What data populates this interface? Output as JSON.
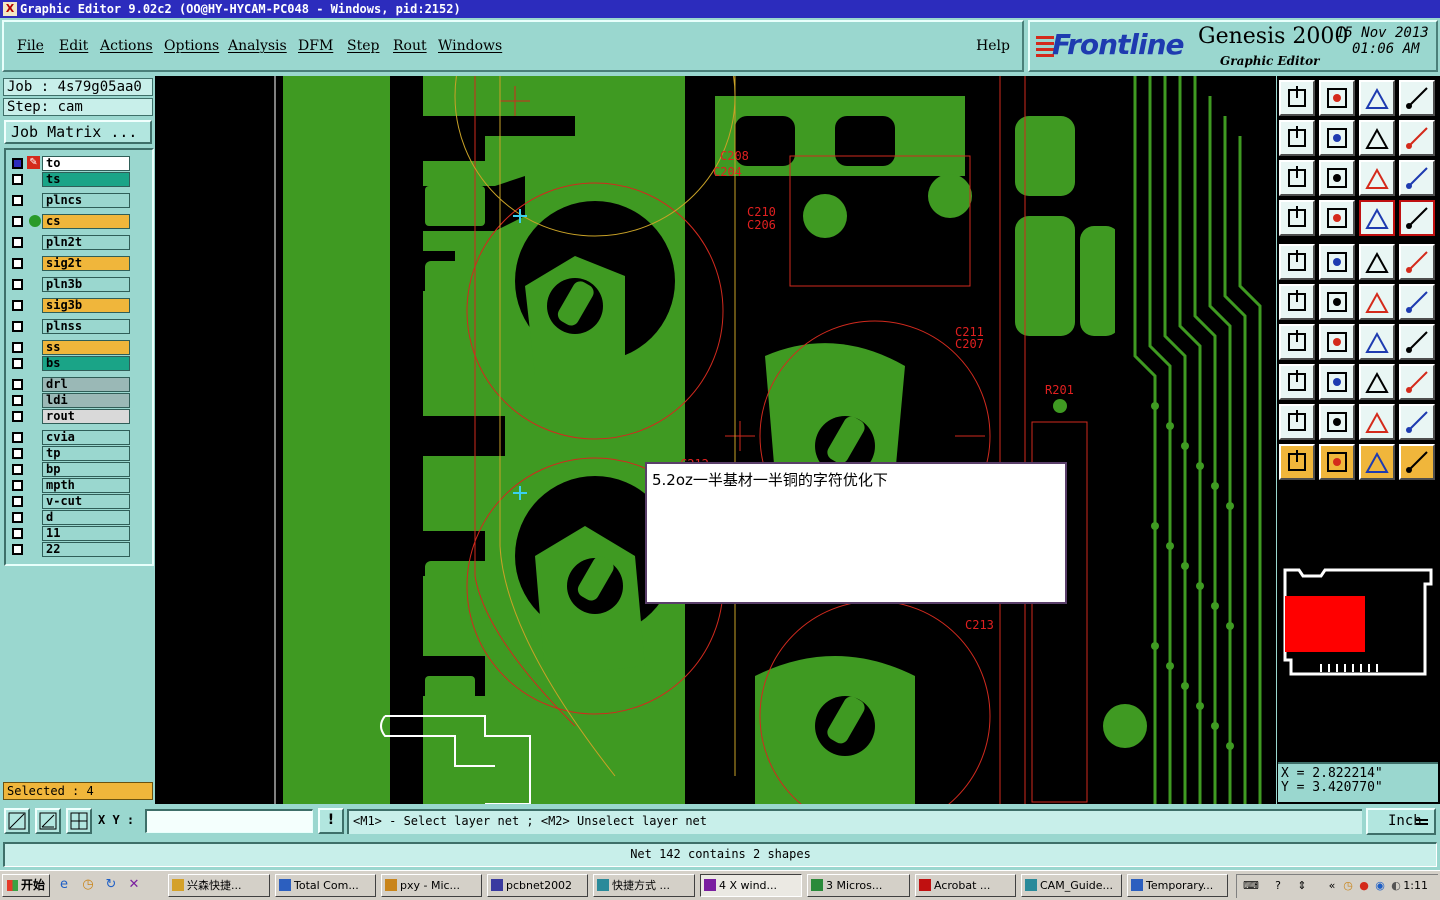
{
  "window": {
    "title": "Graphic Editor 9.02c2 (OO@HY-HYCAM-PC048 - Windows, pid:2152)",
    "title_icon": "X"
  },
  "menu": {
    "items": [
      "File",
      "Edit",
      "Actions",
      "Options",
      "Analysis",
      "DFM",
      "Step",
      "Rout",
      "Windows"
    ],
    "help": "Help"
  },
  "brand": {
    "logo": "Frontline",
    "product": "Genesis 2000",
    "subtitle": "Graphic Editor",
    "date": "15 Nov 2013",
    "time": "01:06 AM"
  },
  "job": {
    "job_text": "Job : 4s79g05aa0",
    "step_text": "Step: cam",
    "matrix_button": "Job Matrix ..."
  },
  "layers": [
    {
      "name": "to",
      "color": "#ffffff",
      "mark": "x"
    },
    {
      "name": "ts",
      "color": "#1aa487",
      "mark": ""
    },
    {
      "name": "plncs",
      "color": "#9ad7cf",
      "mark": ""
    },
    {
      "name": "cs",
      "color": "#f0b63b",
      "mark": "o"
    },
    {
      "name": "pln2t",
      "color": "#9ad7cf",
      "mark": ""
    },
    {
      "name": "sig2t",
      "color": "#f0b63b",
      "mark": ""
    },
    {
      "name": "pln3b",
      "color": "#9ad7cf",
      "mark": ""
    },
    {
      "name": "sig3b",
      "color": "#f0b63b",
      "mark": ""
    },
    {
      "name": "plnss",
      "color": "#9ad7cf",
      "mark": ""
    },
    {
      "name": "ss",
      "color": "#f0b63b",
      "mark": ""
    },
    {
      "name": "bs",
      "color": "#1aa487",
      "mark": ""
    },
    {
      "name": "drl",
      "color": "#9ab8b6",
      "mark": ""
    },
    {
      "name": "ldi",
      "color": "#9ab8b6",
      "mark": ""
    },
    {
      "name": "rout",
      "color": "#d9d9d9",
      "mark": ""
    },
    {
      "name": "cvia",
      "color": "#9ad7cf",
      "mark": ""
    },
    {
      "name": "tp",
      "color": "#9ad7cf",
      "mark": ""
    },
    {
      "name": "bp",
      "color": "#9ad7cf",
      "mark": ""
    },
    {
      "name": "mpth",
      "color": "#9ad7cf",
      "mark": ""
    },
    {
      "name": "v-cut",
      "color": "#9ad7cf",
      "mark": ""
    },
    {
      "name": "d",
      "color": "#9ad7cf",
      "mark": ""
    },
    {
      "name": "11",
      "color": "#9ad7cf",
      "mark": ""
    },
    {
      "name": "22",
      "color": "#9ad7cf",
      "mark": ""
    }
  ],
  "selected_text": "Selected : 4",
  "canvas": {
    "refdes": [
      "C208",
      "C204",
      "C210",
      "C206",
      "C211",
      "C207",
      "R201",
      "C213",
      "C212"
    ],
    "copper_color": "#3f9a22",
    "outline_color": "#d12a1e"
  },
  "popup": {
    "message": "5.2oz一半基材一半铜的字符优化下"
  },
  "tools": [
    "move-to-layer-icon",
    "copy-to-layer-icon",
    "home-icon",
    "window-icon",
    "left-arrow-icon",
    "right-arrow-icon",
    "swap-icon",
    "flip-icon",
    "zoom-fit-icon",
    "zoom-center-icon",
    "zoom-1to1-icon",
    "help-icon",
    "settings-icon",
    "grid-icon",
    "layer-stack-icon",
    "layer-stack-red-icon",
    "pad-select-icon",
    "polygon-icon",
    "ruler-icon",
    "circle-pad-icon",
    "net-icon",
    "cross-icon",
    "line-icon",
    "line-point-icon",
    "angle-icon",
    "slash-icon",
    "arc-icon",
    "mirror-icon",
    "shape-edit-icon",
    "minus-icon",
    "measure-icon",
    "group-icon",
    "triangle-icon",
    "triangle-a-icon",
    "triangle-b-icon",
    "triangle-c-icon",
    "pointer-icon",
    "pointer-box-icon",
    "pointer-box2-icon",
    "pointer-net-icon"
  ],
  "coords": {
    "x_text": "X = 2.822214\"",
    "y_text": "Y = 3.420770\""
  },
  "bottom": {
    "xy_label": "X Y :",
    "xy_value": "",
    "prompt": "<M1> - Select layer net ; <M2> Unselect layer net",
    "unit": "Inch",
    "status": "Net 142 contains 2 shapes",
    "info_button": "!"
  },
  "taskbar": {
    "start": "开始",
    "tasks": [
      "兴森快捷...",
      "Total Com...",
      "pxy - Mic...",
      "pcbnet2002",
      "快捷方式 ...",
      "4 X wind...",
      "3 Micros...",
      "Acrobat ...",
      "CAM_Guide...",
      "Temporary..."
    ],
    "clock": "1:11"
  }
}
